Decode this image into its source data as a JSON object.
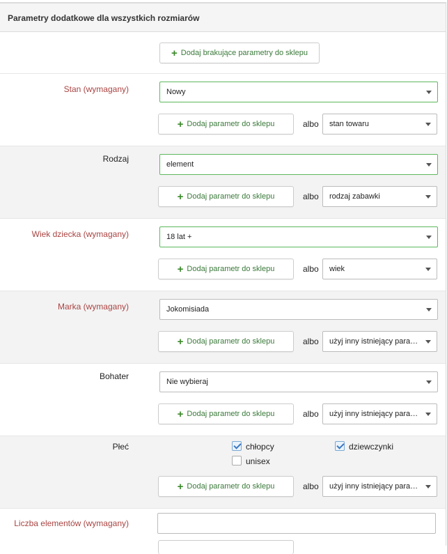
{
  "header": {
    "title": "Parametry dodatkowe dla wszystkich rozmiarów"
  },
  "add_missing_button": "Dodaj brakujące parametry do sklepu",
  "albo": "albo",
  "add_param_button": "Dodaj parametr do sklepu",
  "rows": [
    {
      "label": "Stan (wymagany)",
      "value": "Nowy",
      "alt": "stan towaru"
    },
    {
      "label": "Rodzaj",
      "value": "element",
      "alt": "rodzaj zabawki"
    },
    {
      "label": "Wiek dziecka (wymagany)",
      "value": "18 lat +",
      "alt": "wiek"
    },
    {
      "label": "Marka (wymagany)",
      "value": "Jokomisiada",
      "alt": "użyj inny istniejący param…"
    },
    {
      "label": "Bohater",
      "value": "Nie wybieraj",
      "alt": "użyj inny istniejący param…"
    },
    {
      "label": "Płeć",
      "alt": "użyj inny istniejący param…",
      "options": [
        {
          "label": "chłopcy",
          "checked": true
        },
        {
          "label": "dziewczynki",
          "checked": true
        },
        {
          "label": "unisex",
          "checked": false
        }
      ]
    },
    {
      "label": "Liczba elementów (wymagany)",
      "value": ""
    }
  ],
  "colors": {
    "required_label": "#a94442",
    "valid_border": "#5cb85c",
    "plus_icon": "#3a8a2a"
  }
}
